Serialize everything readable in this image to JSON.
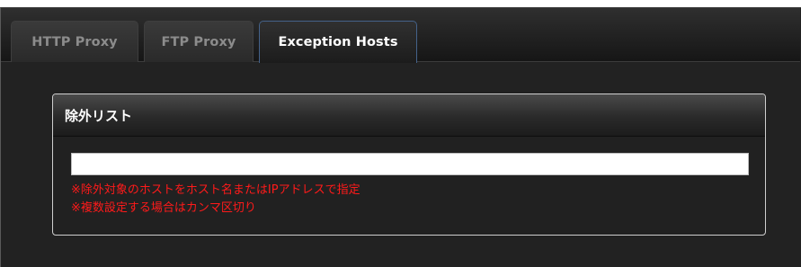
{
  "tabs": [
    {
      "label": "HTTP Proxy",
      "active": false
    },
    {
      "label": "FTP Proxy",
      "active": false
    },
    {
      "label": "Exception Hosts",
      "active": true
    }
  ],
  "exception_panel": {
    "title": "除外リスト",
    "input_value": "",
    "notes": [
      "※除外対象のホストをホスト名またはIPアドレスで指定",
      "※複数設定する場合はカンマ区切り"
    ]
  },
  "colors": {
    "background": "#222222",
    "active_tab_border": "#44628a",
    "note_text": "#ff1a1a",
    "panel_border": "#cfcfcf"
  }
}
